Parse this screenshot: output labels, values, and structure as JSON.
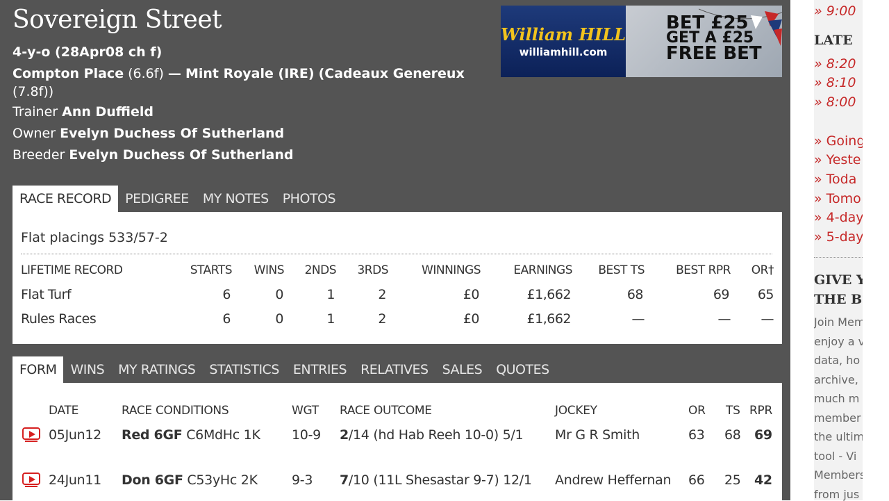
{
  "horse": {
    "name": "Sovereign Street",
    "age_line": "4-y-o (28Apr08 ch f)",
    "sire": "Compton Place",
    "sire_dist": "(6.6f)",
    "dash": "—",
    "dam": "Mint Royale (IRE)",
    "damsire": "(Cadeaux Genereux",
    "damsire_dist": "(7.8f))",
    "trainer_label": "Trainer",
    "trainer": "Ann Duffield",
    "owner_label": "Owner",
    "owner": "Evelyn Duchess Of Sutherland",
    "breeder_label": "Breeder",
    "breeder": "Evelyn Duchess Of Sutherland"
  },
  "ad": {
    "logo": "William HILL",
    "url": "williamhill.com",
    "line1": "BET £25",
    "line2": "GET A £25",
    "line3": "FREE BET"
  },
  "record_tabs": [
    "RACE RECORD",
    "PEDIGREE",
    "MY NOTES",
    "PHOTOS"
  ],
  "record": {
    "placings": "Flat placings 533/57-2",
    "headers": [
      "LIFETIME RECORD",
      "STARTS",
      "WINS",
      "2NDS",
      "3RDS",
      "WINNINGS",
      "EARNINGS",
      "BEST TS",
      "BEST RPR",
      "OR†"
    ],
    "rows": [
      [
        "Flat Turf",
        "6",
        "0",
        "1",
        "2",
        "£0",
        "£1,662",
        "68",
        "69",
        "65"
      ],
      [
        "Rules Races",
        "6",
        "0",
        "1",
        "2",
        "£0",
        "£1,662",
        "—",
        "—",
        "—"
      ]
    ]
  },
  "form_tabs": [
    "FORM",
    "WINS",
    "MY RATINGS",
    "STATISTICS",
    "ENTRIES",
    "RELATIVES",
    "SALES",
    "QUOTES"
  ],
  "form": {
    "headers": [
      "DATE",
      "RACE CONDITIONS",
      "WGT",
      "RACE OUTCOME",
      "JOCKEY",
      "OR",
      "TS",
      "RPR"
    ],
    "rows": [
      {
        "date": "05Jun12",
        "course": "Red 6GF",
        "cond": "C6MdHc 1K",
        "wgt": "10-9",
        "pos": "2",
        "outcome": "/14 (hd Hab Reeh 10-0) 5/1",
        "jockey": "Mr G R Smith",
        "or": "63",
        "ts": "68",
        "rpr": "69"
      },
      {
        "date": "24Jun11",
        "course": "Don 6GF",
        "cond": "C53yHc 2K",
        "wgt": "9-3",
        "pos": "7",
        "outcome": "/10 (11L Shesastar 9-7) 12/1",
        "jockey": "Andrew Heffernan",
        "or": "66",
        "ts": "25",
        "rpr": "42"
      }
    ]
  },
  "sidebar": {
    "times_top": [
      "» 9:00"
    ],
    "latest_heading": "LATE",
    "times": [
      "» 8:20",
      "» 8:10",
      "» 8:00"
    ],
    "links": [
      "» Going",
      "» Yeste",
      "» Toda",
      "» Tomo",
      "» 4-day",
      "» 5-day"
    ],
    "give_heading_1": "GIVE Y",
    "give_heading_2": "THE B",
    "paragraph": [
      "Join Mem",
      "enjoy a v",
      "data, ho",
      "archive,",
      "much m",
      "member",
      "the ultim",
      "tool - Vi",
      "Members",
      "from jus"
    ]
  },
  "colors": {
    "panel": "#545454",
    "accent": "#c62828",
    "video": "#d62020"
  }
}
